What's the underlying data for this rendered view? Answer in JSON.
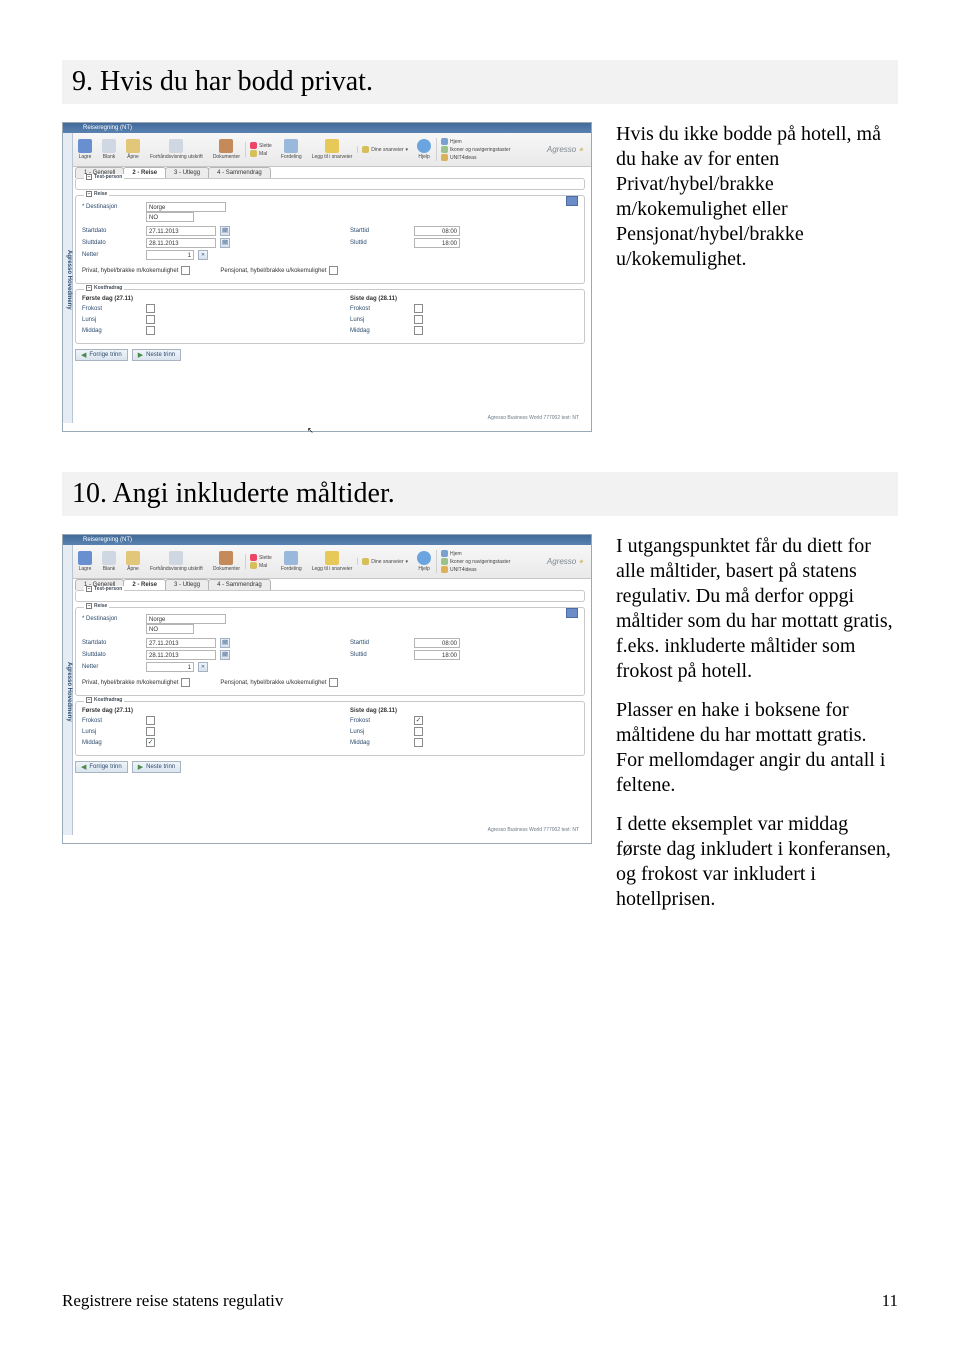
{
  "section1": {
    "heading": "9. Hvis du har bodd privat.",
    "desc_p1": "Hvis du ikke bodde på hotell, må du hake av for enten Privat/hybel/brakke m/kokemulighet eller Pensjonat/hybel/brakke u/kokemulighet."
  },
  "section2": {
    "heading": "10. Angi inkluderte måltider.",
    "desc_p1": "I utgangspunktet får du diett for alle måltider, basert på statens regulativ. Du må derfor oppgi måltider som du har mottatt gratis, f.eks. inkluderte måltider som frokost på hotell.",
    "desc_p2": "Plasser en hake i boksene for måltidene du har mottatt gratis. For mellomdager angir du antall i feltene.",
    "desc_p3": "I dette eksemplet var middag første dag inkludert i konferansen, og frokost var inkludert i hotellprisen."
  },
  "app": {
    "title": "Reiseregning (NT)",
    "sidebar": "Agresso Hovedmeny",
    "brand": "Agresso",
    "footer": "Agresso Business World  777002  test: NT",
    "toolbar": {
      "save": "Lagre",
      "erase": "Blank",
      "open": "Åpne",
      "preview": "Forhåndsvisning utskrift",
      "docs": "Dokumenter",
      "del": "Slette",
      "tpl": "Mal",
      "fordeling": "Fordeling",
      "addfav": "Legg til i snarveier",
      "shortcuts": "Dine snarveier",
      "help": "Hjelp",
      "home": "Hjem",
      "navkeys": "Ikoner og navigeringstaster",
      "user": "UNIT4ideas"
    },
    "tabs": [
      "1 - Generell",
      "2 - Reise",
      "3 - Utlegg",
      "4 - Sammendrag"
    ],
    "active_tab": 1,
    "groups": {
      "testperson": "Test-person",
      "reise": "Reise",
      "kost": "Kostfradrag"
    },
    "labels": {
      "destinasjon": "Destinasjon",
      "startdato": "Startdato",
      "sluttdato": "Sluttdato",
      "netter": "Netter",
      "starttid": "Starttid",
      "sluttid": "Sluttid",
      "privat": "Privat, hybel/brakke m/kokemulighet",
      "pensjonat": "Pensjonat, hybel/brakke u/kokemulighet",
      "forste": "Første dag (27.11)",
      "siste": "Siste dag (28.11)",
      "frokost": "Frokost",
      "lunsj": "Lunsj",
      "middag": "Middag",
      "forrige": "Forrige trinn",
      "neste": "Neste trinn"
    },
    "values": {
      "country1": "Norge",
      "country2": "NO",
      "startdato": "27.11.2013",
      "sluttdato": "28.11.2013",
      "starttid": "08:00",
      "sluttid": "18:00",
      "netter": "1"
    }
  },
  "footer": {
    "left": "Registrere reise statens regulativ",
    "right": "11"
  }
}
